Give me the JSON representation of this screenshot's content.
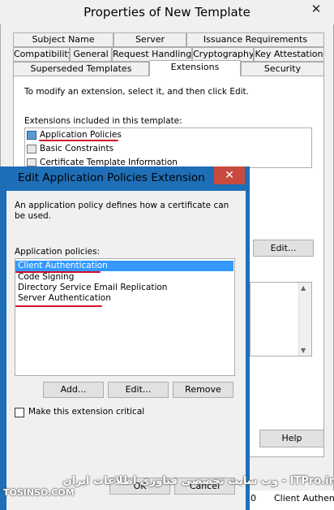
{
  "back_window": {
    "title": "Properties of New Template",
    "close_glyph": "✕",
    "tabs_row1": [
      "Subject Name",
      "Server",
      "Issuance Requirements"
    ],
    "tabs_row2": [
      "Compatibility",
      "General",
      "Request Handling",
      "Cryptography",
      "Key Attestation"
    ],
    "tabs_row3": [
      "Superseded Templates",
      "Extensions",
      "Security"
    ],
    "instruction": "To modify an extension, select it, and then click Edit.",
    "extensions_label": "Extensions included in this template:",
    "extensions": [
      "Application Policies",
      "Basic Constraints",
      "Certificate Template Information"
    ],
    "edit_button": "Edit...",
    "help_button": "Help",
    "status_number": "0",
    "status_text": "Client Authen"
  },
  "dialog": {
    "title": "Edit Application Policies Extension",
    "close_glyph": "✕",
    "description": "An application policy defines how a certificate can be used.",
    "policies_label": "Application policies:",
    "policies": [
      "Client Authentication",
      "Code Signing",
      "Directory Service Email Replication",
      "Server Authentication"
    ],
    "add_button": "Add...",
    "edit_button": "Edit...",
    "remove_button": "Remove",
    "critical_checkbox_label": "Make this extension critical",
    "critical_checked": false,
    "ok_button": "OK",
    "cancel_button": "Cancel"
  },
  "watermark": {
    "site": "ITPro.ir - وب سایت تخصصی فناوری اطلاعات ایران",
    "brand": "TOSINSO.COM"
  },
  "colors": {
    "selection": "#3399ff",
    "dialog_frame": "#1e6fb8",
    "close_button": "#c94b3f",
    "annotation_red": "#d1112b"
  }
}
